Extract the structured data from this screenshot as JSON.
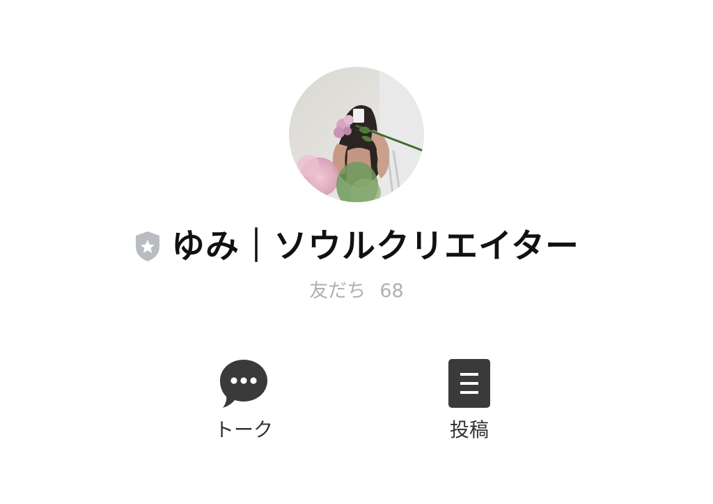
{
  "profile": {
    "name": "ゆみ｜ソウルクリエイター",
    "friends_label": "友だち",
    "friends_count": "68",
    "badge_icon": "shield-star-icon"
  },
  "actions": [
    {
      "label": "トーク",
      "icon": "chat-bubble-icon"
    },
    {
      "label": "投稿",
      "icon": "document-icon"
    }
  ],
  "colors": {
    "name_text": "#111111",
    "friends_text": "#b0b0b0",
    "action_icon": "#3a3a3a",
    "badge": "#b9bcc1"
  }
}
